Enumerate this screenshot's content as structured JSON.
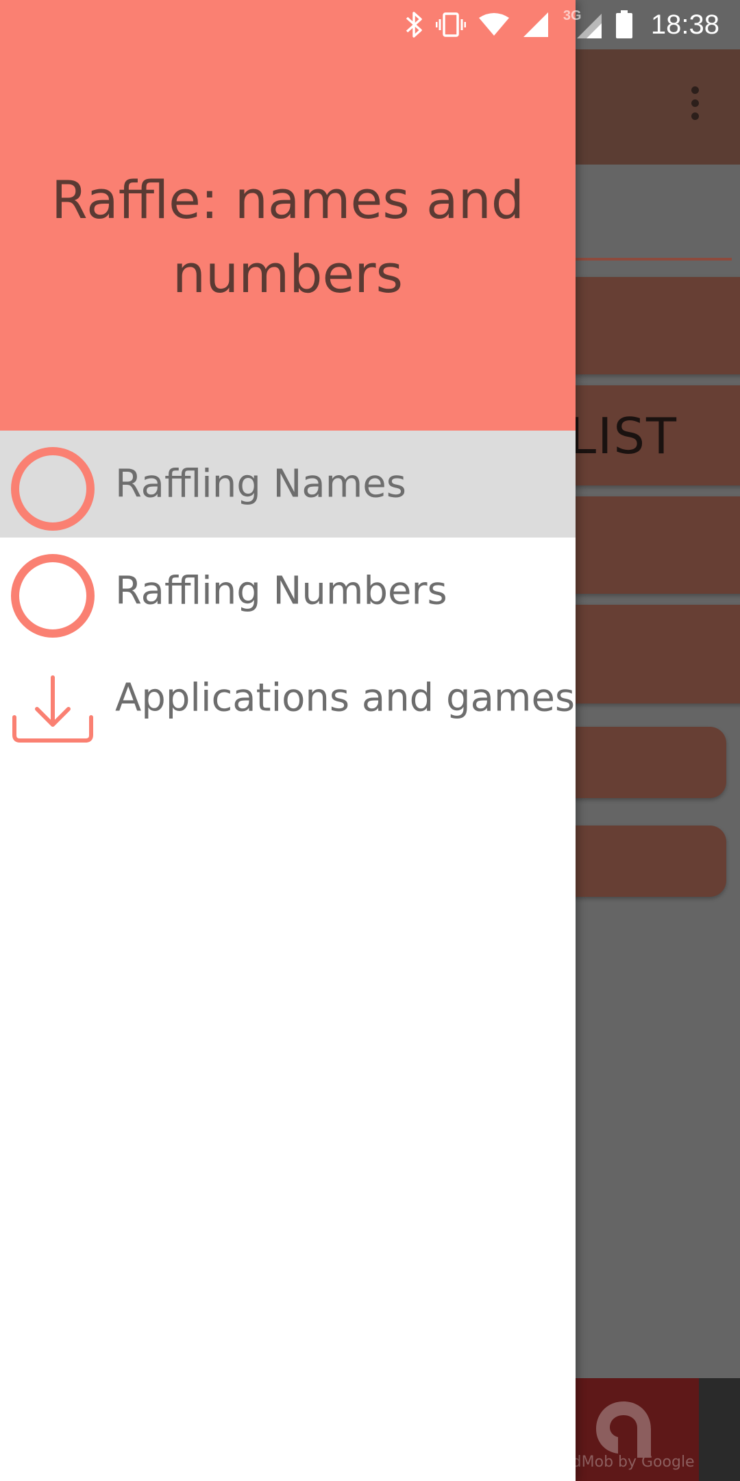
{
  "status_bar": {
    "time": "18:38",
    "network": "3G",
    "icons": [
      "bluetooth-icon",
      "vibrate-icon",
      "wifi-icon",
      "signal-icon",
      "signal-3g-icon",
      "battery-icon"
    ]
  },
  "drawer": {
    "title": "Raffle: names and numbers",
    "menu": [
      {
        "label": "Raffling Names",
        "icon": "circle-icon",
        "active": true
      },
      {
        "label": "Raffling Numbers",
        "icon": "circle-icon",
        "active": false
      },
      {
        "label": "Applications and games",
        "icon": "download-icon",
        "active": false
      }
    ]
  },
  "background": {
    "list_button_text": "LIST",
    "ad_text": "AdMob by Google"
  },
  "colors": {
    "accent": "#fa8072",
    "toolbar": "#5b3d33",
    "button": "#673f34",
    "menu_text": "#6d6d6d",
    "active_row": "#dcdcdc"
  }
}
